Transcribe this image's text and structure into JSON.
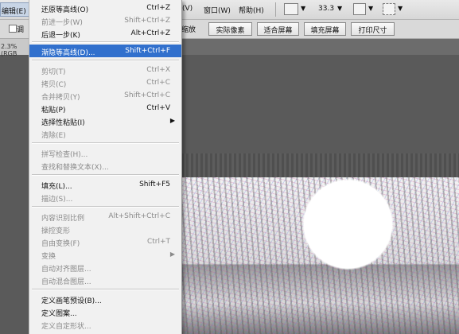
{
  "menubar": {
    "edit": "编辑(E)",
    "view": "(V)",
    "window": "窗口(W)",
    "help": "帮助(H)",
    "zoom": "33.3",
    "caret": "▼"
  },
  "options": {
    "adjust_partial": "调",
    "zoom_partial": "缩放",
    "actual_pixels": "实际像素",
    "fit_screen": "适合屏幕",
    "fill_screen": "填充屏幕",
    "print_size": "打印尺寸"
  },
  "document": {
    "tab_partial": "2.3%(RGB"
  },
  "edit_menu": {
    "undo": {
      "label": "还原等高线(O)",
      "shortcut": "Ctrl+Z"
    },
    "step_forward": {
      "label": "前进一步(W)",
      "shortcut": "Shift+Ctrl+Z"
    },
    "step_backward": {
      "label": "后退一步(K)",
      "shortcut": "Alt+Ctrl+Z"
    },
    "fade": {
      "label": "渐隐等高线(D)...",
      "shortcut": "Shift+Ctrl+F"
    },
    "cut": {
      "label": "剪切(T)",
      "shortcut": "Ctrl+X"
    },
    "copy": {
      "label": "拷贝(C)",
      "shortcut": "Ctrl+C"
    },
    "copy_merged": {
      "label": "合并拷贝(Y)",
      "shortcut": "Shift+Ctrl+C"
    },
    "paste": {
      "label": "粘贴(P)",
      "shortcut": "Ctrl+V"
    },
    "paste_special": {
      "label": "选择性粘贴(I)",
      "submenu": "▶"
    },
    "clear": {
      "label": "清除(E)"
    },
    "spell_check": {
      "label": "拼写检查(H)..."
    },
    "find_replace": {
      "label": "查找和替换文本(X)..."
    },
    "fill": {
      "label": "填充(L)...",
      "shortcut": "Shift+F5"
    },
    "stroke": {
      "label": "描边(S)..."
    },
    "content_aware_scale": {
      "label": "内容识别比例",
      "shortcut": "Alt+Shift+Ctrl+C"
    },
    "puppet_warp": {
      "label": "操控变形"
    },
    "free_transform": {
      "label": "自由变换(F)",
      "shortcut": "Ctrl+T"
    },
    "transform": {
      "label": "变换",
      "submenu": "▶"
    },
    "auto_align": {
      "label": "自动对齐图层..."
    },
    "auto_blend": {
      "label": "自动混合图层..."
    },
    "define_brush": {
      "label": "定义画笔预设(B)..."
    },
    "define_pattern": {
      "label": "定义图案..."
    },
    "define_shape": {
      "label": "定义自定形状..."
    }
  }
}
